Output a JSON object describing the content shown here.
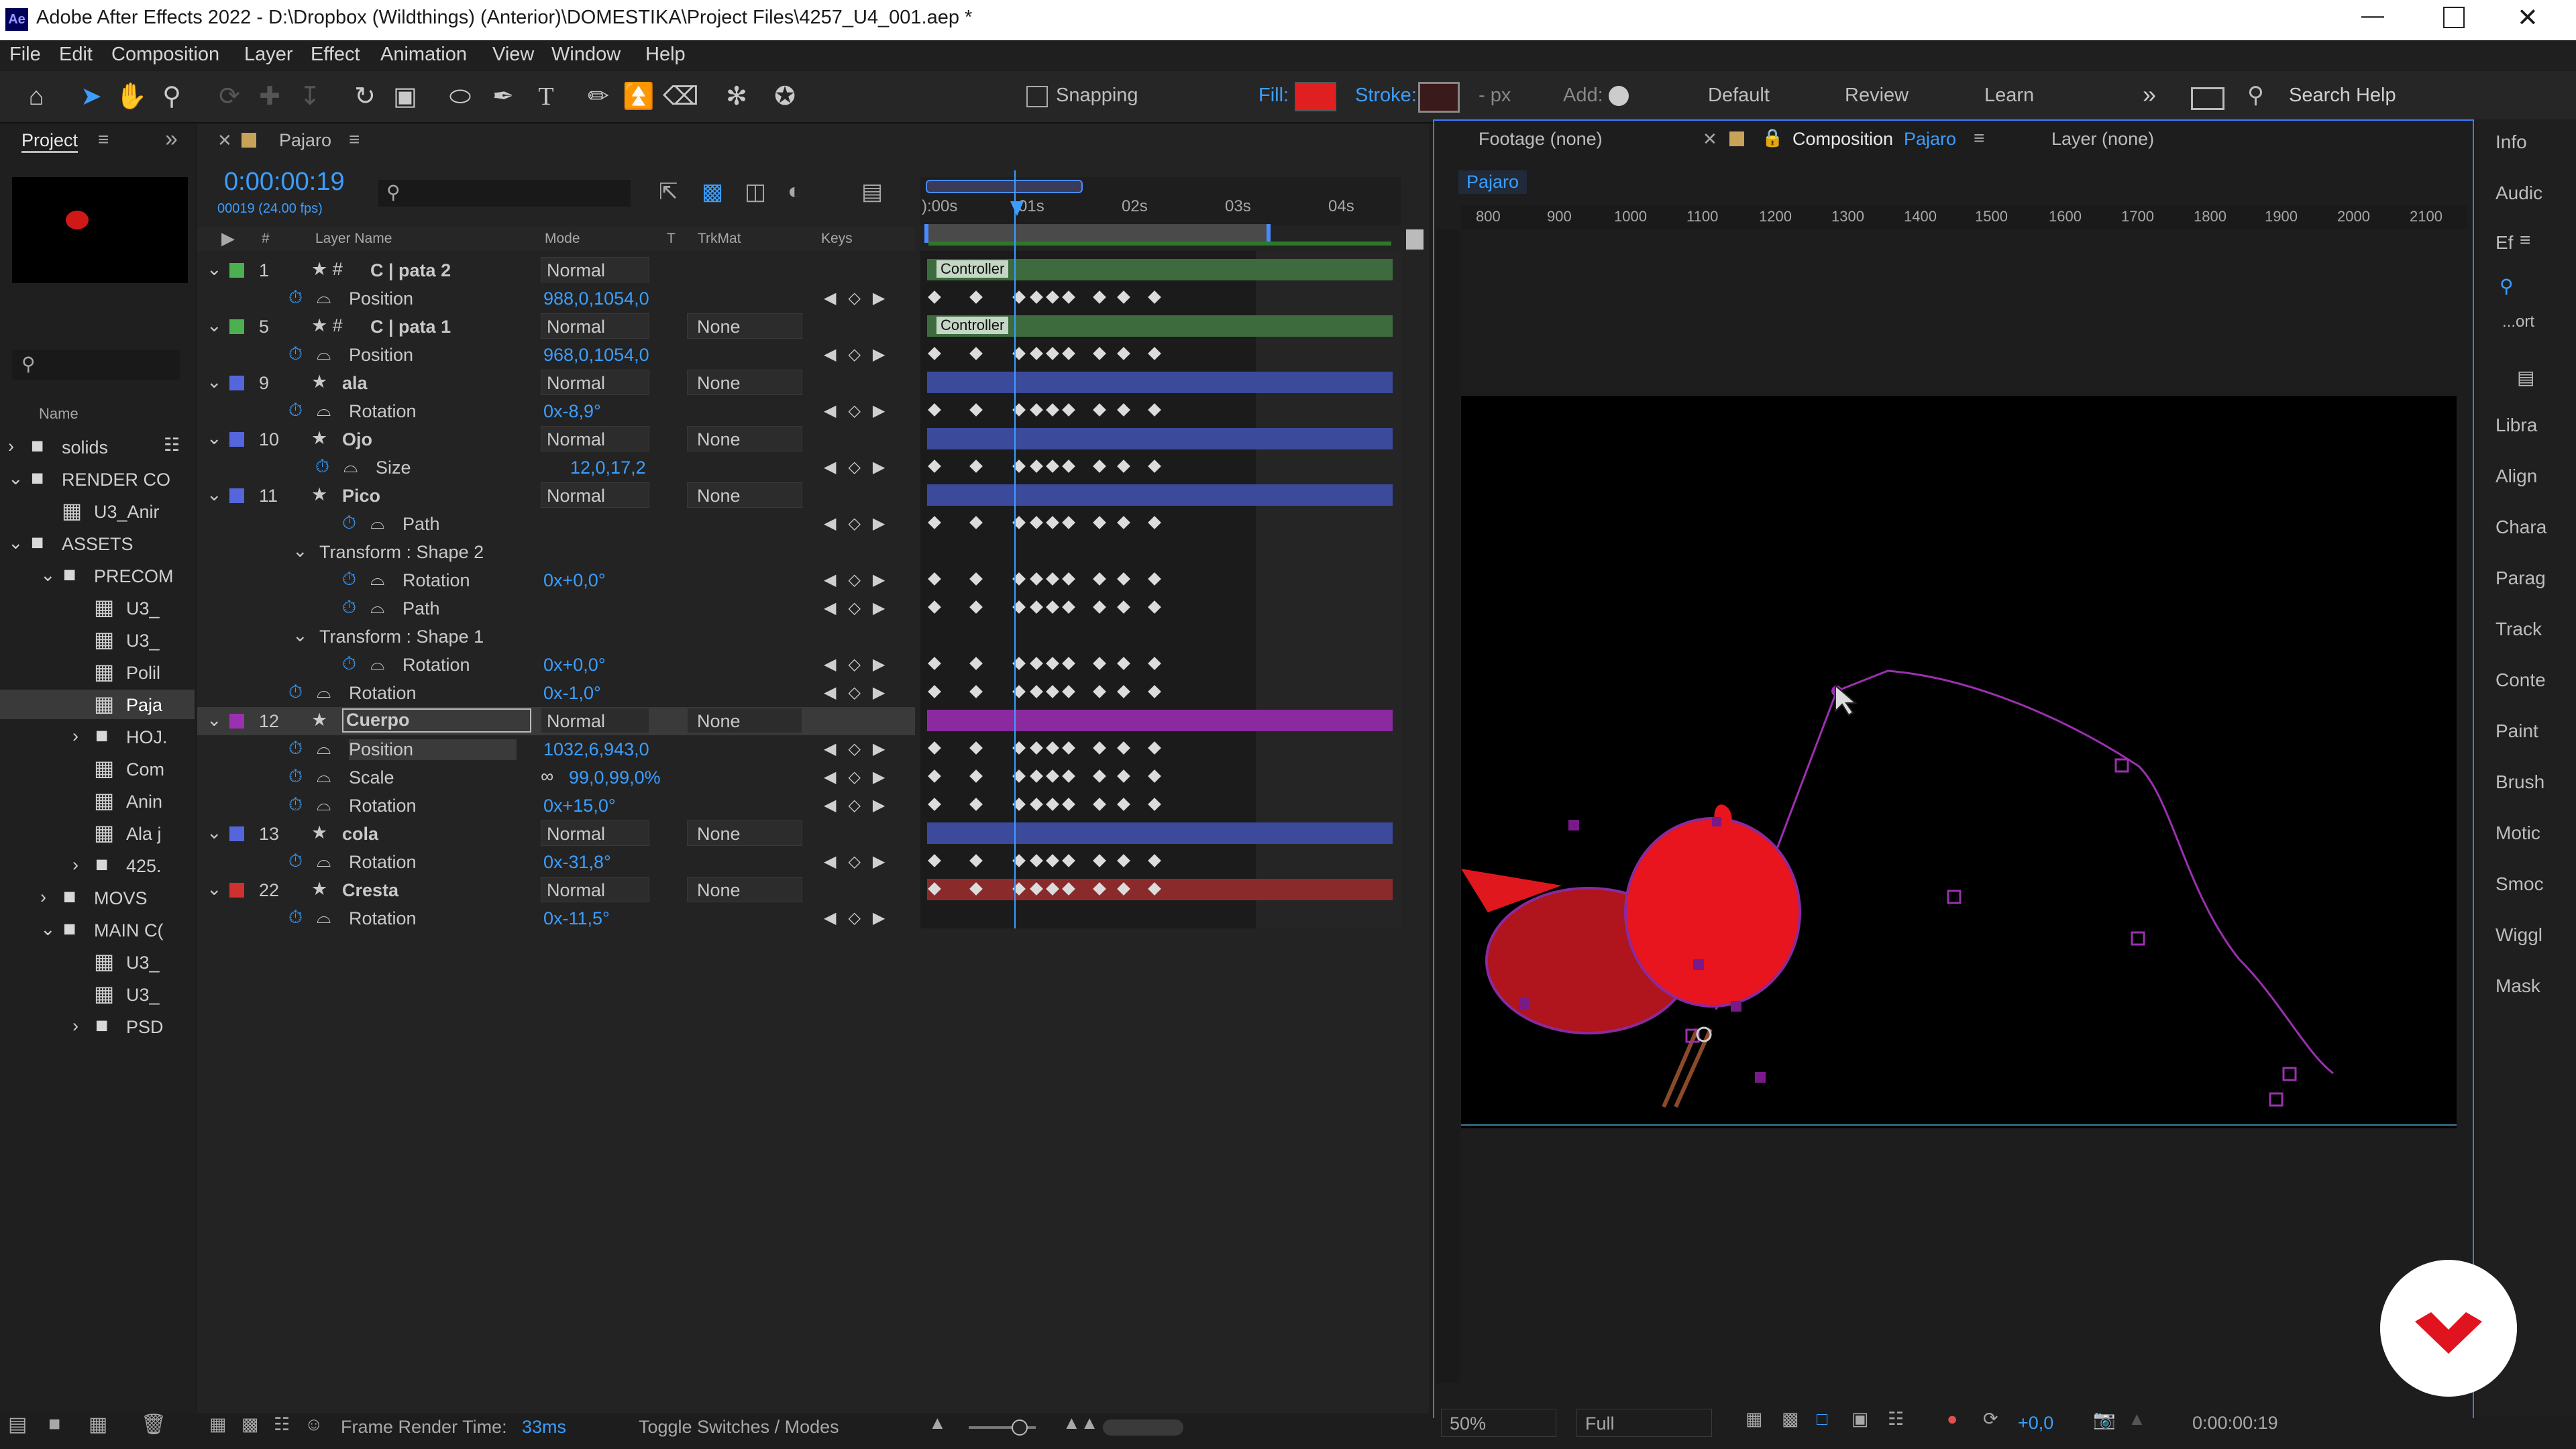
{
  "app": {
    "title": "Adobe After Effects 2022 - D:\\Dropbox (Wildthings) (Anterior)\\DOMESTIKA\\Project Files\\4257_U4_001.aep *"
  },
  "menu": [
    "File",
    "Edit",
    "Composition",
    "Layer",
    "Effect",
    "Animation",
    "View",
    "Window",
    "Help"
  ],
  "toolbar": {
    "snapping": "Snapping",
    "fill": "Fill:",
    "stroke": "Stroke:",
    "stroke_px": "- px",
    "add": "Add:",
    "workspaces": [
      "Default",
      "Review",
      "Learn"
    ],
    "search_help": "Search Help",
    "fill_color": "#e02020"
  },
  "project": {
    "tab": "Project",
    "name_header": "Name",
    "items": [
      {
        "label": "solids",
        "type": "folder"
      },
      {
        "label": "RENDER CO",
        "type": "folder"
      },
      {
        "label": "U3_Anir",
        "type": "comp"
      },
      {
        "label": "ASSETS",
        "type": "folder"
      },
      {
        "label": "PRECOM",
        "type": "folder"
      },
      {
        "label": "U3_",
        "type": "comp"
      },
      {
        "label": "U3_",
        "type": "comp"
      },
      {
        "label": "Polil",
        "type": "comp"
      },
      {
        "label": "Paja",
        "type": "comp"
      },
      {
        "label": "HOJ.",
        "type": "folder"
      },
      {
        "label": "Com",
        "type": "comp"
      },
      {
        "label": "Anin",
        "type": "comp"
      },
      {
        "label": "Ala j",
        "type": "comp"
      },
      {
        "label": "425.",
        "type": "folder"
      },
      {
        "label": "MOVS",
        "type": "folder"
      },
      {
        "label": "MAIN C(",
        "type": "folder"
      },
      {
        "label": "U3_",
        "type": "comp"
      },
      {
        "label": "U3_",
        "type": "comp"
      },
      {
        "label": "PSD",
        "type": "folder"
      }
    ]
  },
  "timeline": {
    "tab": "Pajaro",
    "timecode": "0:00:00:19",
    "frames": "00019 (24.00 fps)",
    "headers": {
      "num": "#",
      "layer_name": "Layer Name",
      "mode": "Mode",
      "t": "T",
      "trkmat": "TrkMat",
      "keys": "Keys"
    },
    "ruler": [
      "):00s",
      "01s",
      "02s",
      "03s",
      "04s"
    ],
    "layers": [
      {
        "num": "1",
        "name": "C | pata 2",
        "mode": "Normal",
        "trkmat": "",
        "color": "#4caf50",
        "prop": "Position",
        "value": "988,0,1054,0"
      },
      {
        "num": "5",
        "name": "C | pata 1",
        "mode": "Normal",
        "trkmat": "None",
        "color": "#4caf50",
        "prop": "Position",
        "value": "968,0,1054,0"
      },
      {
        "num": "9",
        "name": "ala",
        "mode": "Normal",
        "trkmat": "None",
        "color": "#5566dd",
        "prop": "Rotation",
        "value": "0x-8,9°"
      },
      {
        "num": "10",
        "name": "Ojo",
        "mode": "Normal",
        "trkmat": "None",
        "color": "#5566dd",
        "prop": "Size",
        "value": "12,0,17,2"
      },
      {
        "num": "11",
        "name": "Pico",
        "mode": "Normal",
        "trkmat": "None",
        "color": "#5566dd",
        "prop": "Path",
        "value": ""
      }
    ],
    "pico_sub": [
      {
        "label": "Transform : Shape 2",
        "value": ""
      },
      {
        "label": "Rotation",
        "value": "0x+0,0°"
      },
      {
        "label": "Path",
        "value": ""
      },
      {
        "label": "Transform : Shape 1",
        "value": ""
      },
      {
        "label": "Rotation",
        "value": "0x+0,0°"
      },
      {
        "label": "Rotation",
        "value": "0x-1,0°"
      }
    ],
    "cuerpo": {
      "num": "12",
      "name": "Cuerpo",
      "mode": "Normal",
      "trkmat": "None",
      "color": "#9b30b0",
      "props": [
        {
          "label": "Position",
          "value": "1032,6,943,0"
        },
        {
          "label": "Scale",
          "value": "99,0,99,0%"
        },
        {
          "label": "Rotation",
          "value": "0x+15,0°"
        }
      ]
    },
    "cola": {
      "num": "13",
      "name": "cola",
      "mode": "Normal",
      "trkmat": "None",
      "color": "#5566dd",
      "prop": "Rotation",
      "value": "0x-31,8°"
    },
    "cresta": {
      "num": "22",
      "name": "Cresta",
      "mode": "Normal",
      "trkmat": "None",
      "color": "#d03030",
      "prop": "Rotation",
      "value": "0x-11,5°"
    },
    "controller": "Controller",
    "footer": {
      "frame_render_time": "Frame Render Time:",
      "render_ms": "33ms",
      "toggle": "Toggle Switches / Modes"
    }
  },
  "viewer": {
    "tabs": {
      "footage": "Footage  (none)",
      "composition": "Composition",
      "comp_name": "Pajaro",
      "layer": "Layer  (none)"
    },
    "comp_chip": "Pajaro",
    "ruler": [
      "800",
      "900",
      "1000",
      "1100",
      "1200",
      "1300",
      "1400",
      "1500",
      "1600",
      "1700",
      "1800",
      "1900",
      "2000",
      "2100"
    ],
    "zoom": "50%",
    "resolution": "Full",
    "exposure": "+0,0",
    "timecode": "0:00:00:19"
  },
  "right_panels": [
    "Info",
    "Audic",
    "Ef",
    "Libra",
    "Align",
    "Chara",
    "Parag",
    "Track",
    "Conte",
    "Paint",
    "Brush",
    "Motic",
    "Smoc",
    "Wiggl",
    "Mask"
  ],
  "right_extra": "...ort"
}
